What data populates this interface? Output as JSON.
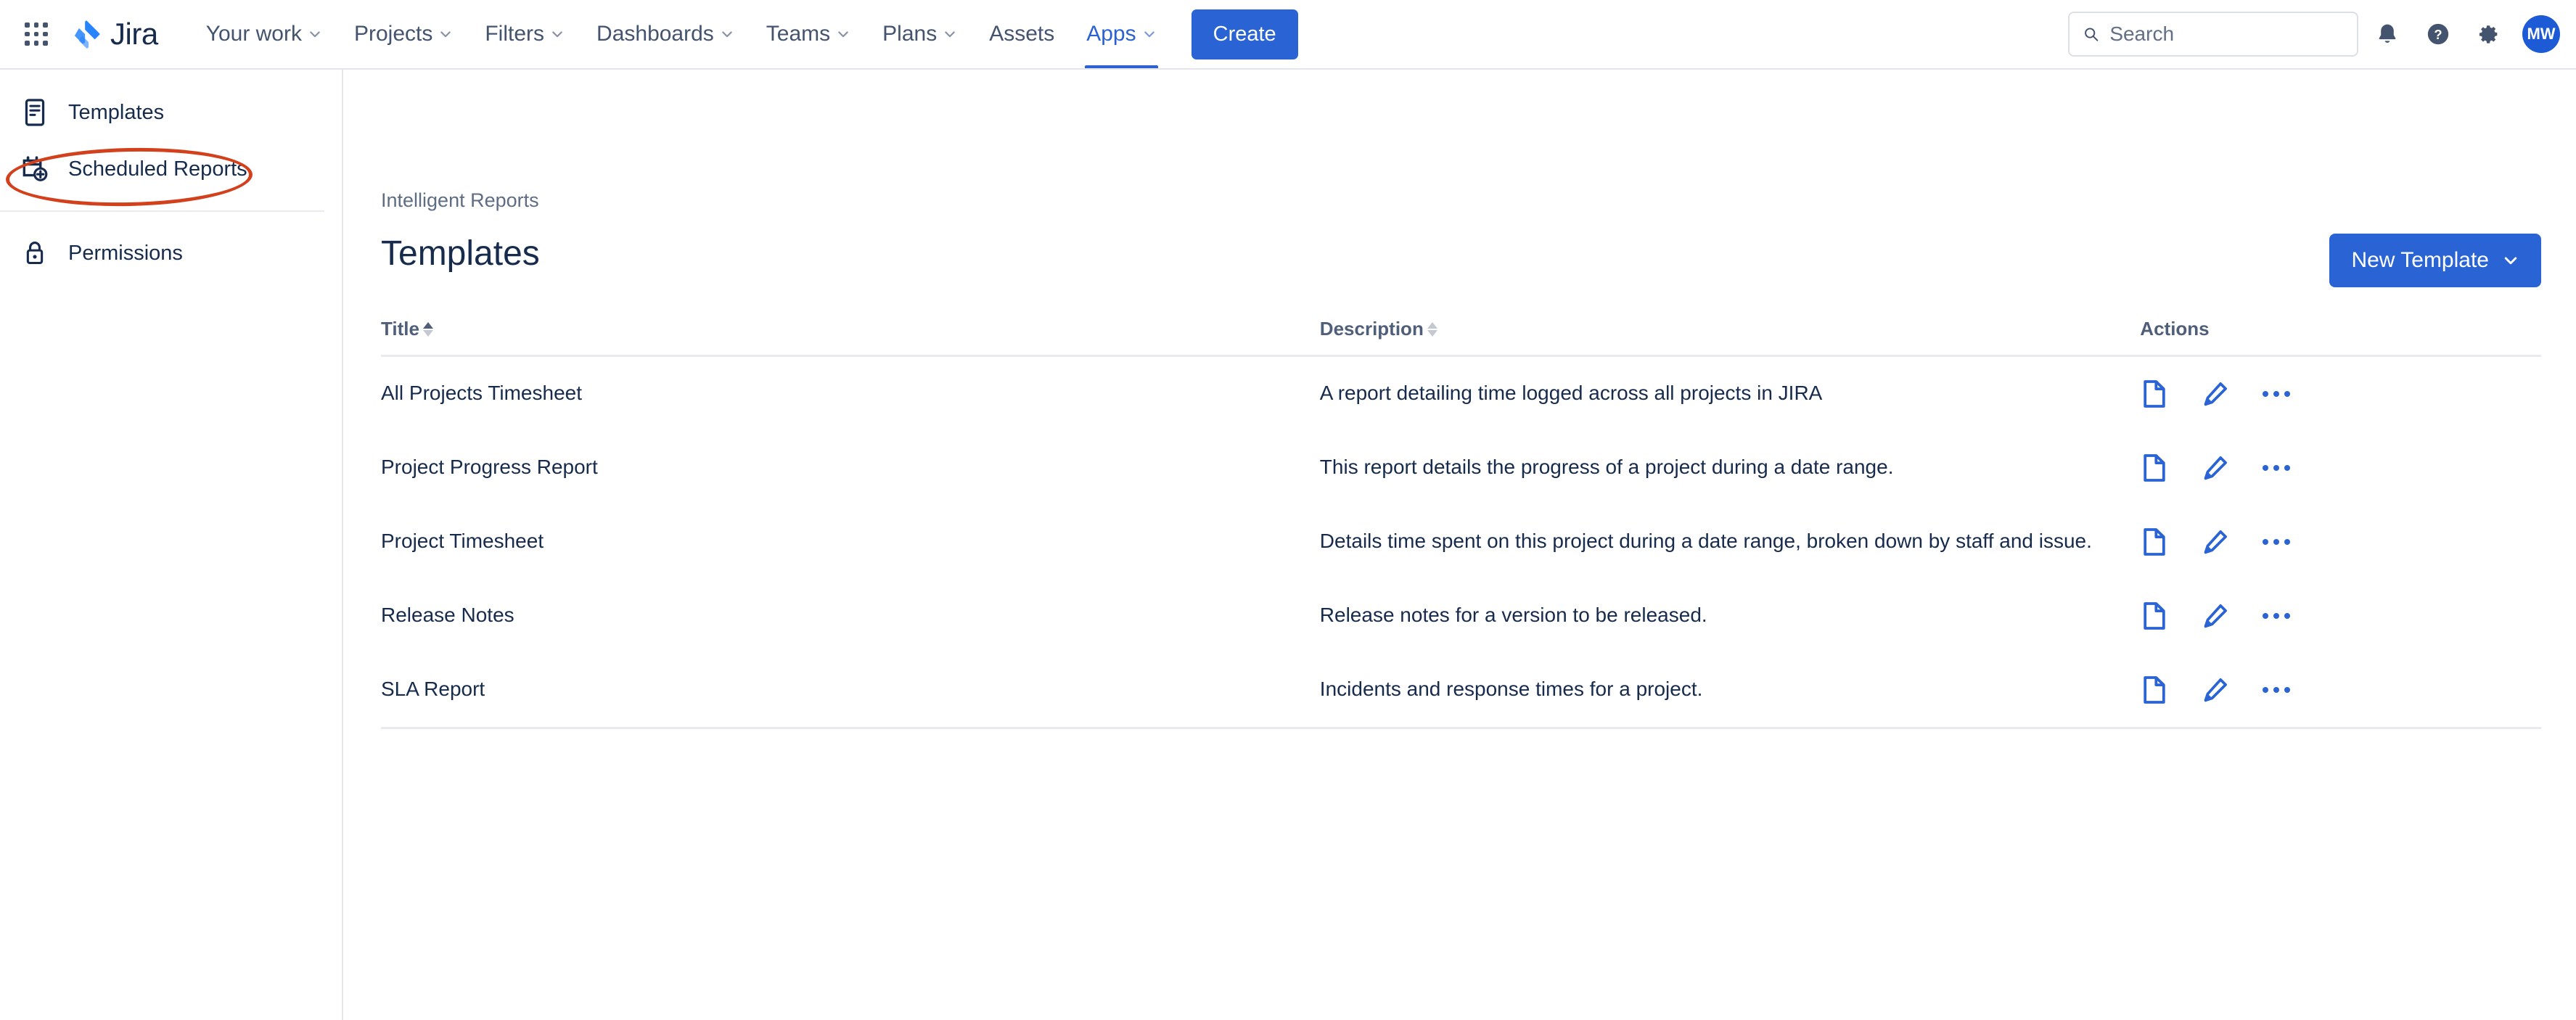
{
  "topnav": {
    "app_switcher_label": "app-switcher",
    "brand": "Jira",
    "items": [
      {
        "label": "Your work",
        "has_caret": true,
        "active": false
      },
      {
        "label": "Projects",
        "has_caret": true,
        "active": false
      },
      {
        "label": "Filters",
        "has_caret": true,
        "active": false
      },
      {
        "label": "Dashboards",
        "has_caret": true,
        "active": false
      },
      {
        "label": "Teams",
        "has_caret": true,
        "active": false
      },
      {
        "label": "Plans",
        "has_caret": true,
        "active": false
      },
      {
        "label": "Assets",
        "has_caret": false,
        "active": false
      },
      {
        "label": "Apps",
        "has_caret": true,
        "active": true
      }
    ],
    "create_label": "Create",
    "search": {
      "value": "",
      "placeholder": "Search"
    },
    "right_icons": [
      "notifications-bell-icon",
      "help-icon",
      "settings-gear-icon"
    ],
    "avatar_initials": "MW",
    "accent_color": "#2a63d4",
    "active_nav_color": "#2b61d1"
  },
  "sidebar": {
    "groups": [
      {
        "items": [
          {
            "label": "Templates",
            "icon": "document-lines-icon",
            "annotated": true
          },
          {
            "label": "Scheduled Reports",
            "icon": "calendar-plus-icon",
            "annotated": false
          }
        ]
      },
      {
        "items": [
          {
            "label": "Permissions",
            "icon": "lock-icon",
            "annotated": false
          }
        ]
      }
    ],
    "annotation_color": "#d2401c"
  },
  "main": {
    "breadcrumb": "Intelligent Reports",
    "page_title": "Templates",
    "new_template_label": "New Template",
    "table": {
      "headers": {
        "title": "Title",
        "description": "Description",
        "actions": "Actions"
      },
      "sort": {
        "column": "Title",
        "direction": "asc"
      },
      "rows": [
        {
          "title": "All Projects Timesheet",
          "description": "A report detailing time logged across all projects in JIRA",
          "actions": [
            "document-icon",
            "edit-pencil-icon",
            "more-actions-icon"
          ]
        },
        {
          "title": "Project Progress Report",
          "description": "This report details the progress of a project during a date range.",
          "actions": [
            "document-icon",
            "edit-pencil-icon",
            "more-actions-icon"
          ]
        },
        {
          "title": "Project Timesheet",
          "description": "Details time spent on this project during a date range, broken down by staff and issue.",
          "actions": [
            "document-icon",
            "edit-pencil-icon",
            "more-actions-icon"
          ]
        },
        {
          "title": "Release Notes",
          "description": "Release notes for a version to be released.",
          "actions": [
            "document-icon",
            "edit-pencil-icon",
            "more-actions-icon"
          ]
        },
        {
          "title": "SLA Report",
          "description": "Incidents and response times for a project.",
          "actions": [
            "document-icon",
            "edit-pencil-icon",
            "more-actions-icon"
          ]
        }
      ]
    }
  }
}
